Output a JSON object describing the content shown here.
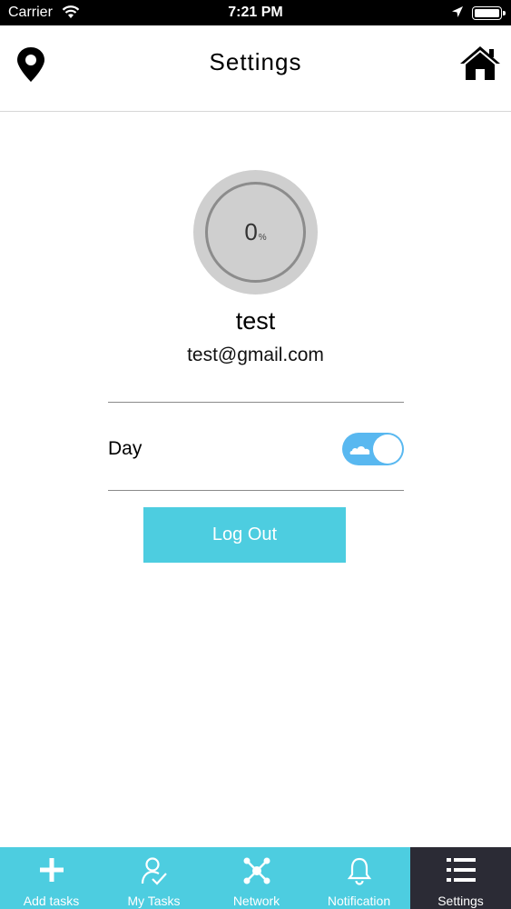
{
  "status_bar": {
    "carrier": "Carrier",
    "time": "7:21 PM"
  },
  "nav": {
    "title": "Settings",
    "left_icon": "map-pin-icon",
    "right_icon": "home-icon"
  },
  "profile": {
    "progress_value": "0",
    "progress_unit": "%",
    "name": "test",
    "email": "test@gmail.com"
  },
  "theme": {
    "label": "Day",
    "toggle_on": true
  },
  "logout": {
    "label": "Log Out"
  },
  "tabs": [
    {
      "label": "Add tasks",
      "icon": "plus-icon",
      "active": false
    },
    {
      "label": "My Tasks",
      "icon": "user-check-icon",
      "active": false
    },
    {
      "label": "Network",
      "icon": "network-icon",
      "active": false
    },
    {
      "label": "Notification",
      "icon": "bell-icon",
      "active": false
    },
    {
      "label": "Settings",
      "icon": "list-icon",
      "active": true
    }
  ],
  "colors": {
    "accent": "#4dcde0",
    "tab_active_bg": "#2b2b35",
    "toggle_bg": "#59b8f0"
  }
}
